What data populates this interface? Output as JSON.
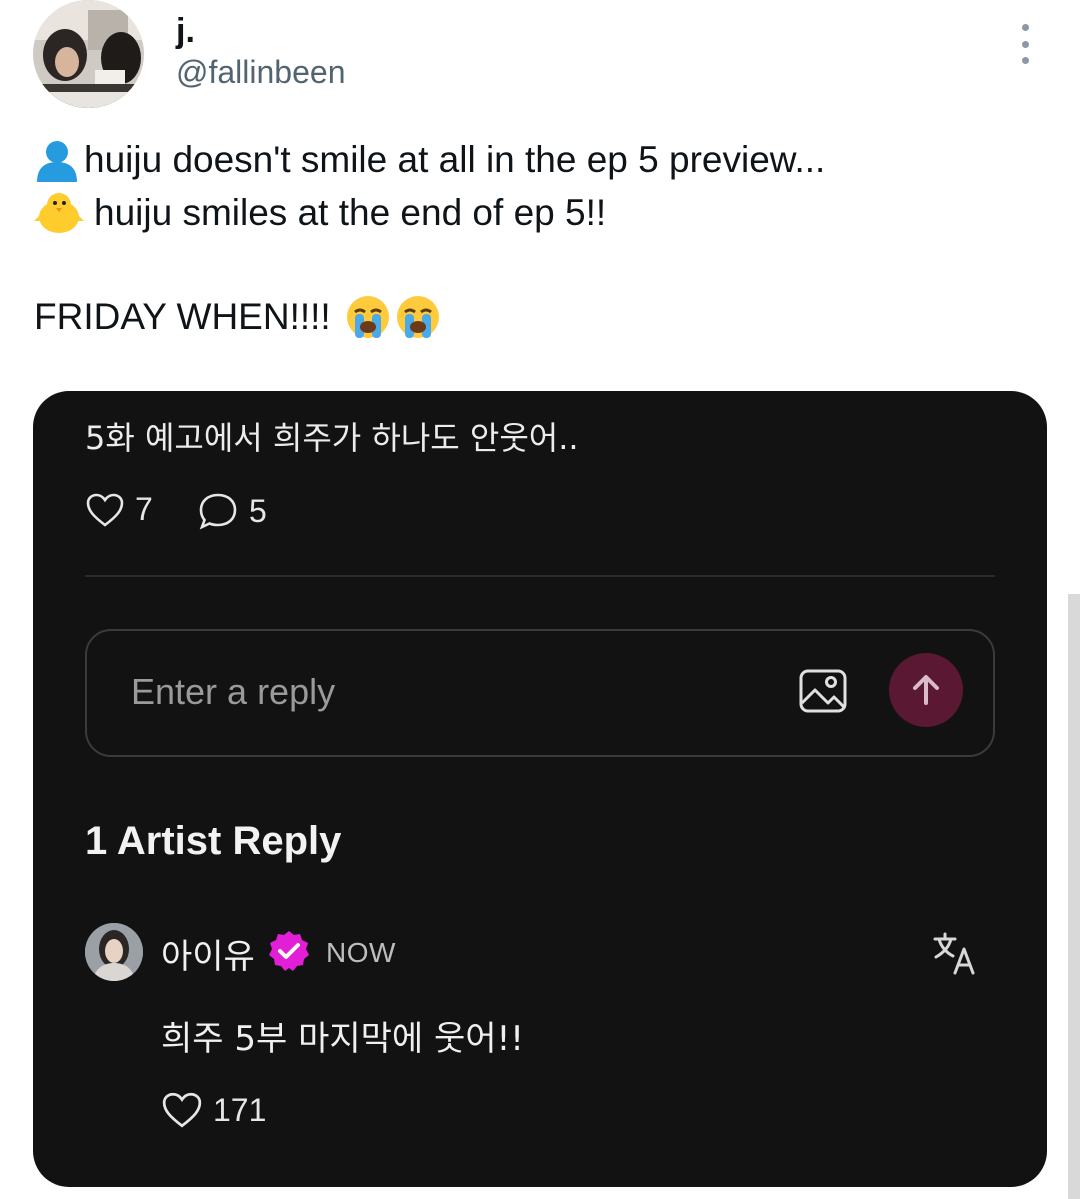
{
  "tweet": {
    "author": {
      "display_name": "j.",
      "handle": "@fallinbeen"
    },
    "lines": [
      {
        "icon": "bust-in-silhouette-emoji",
        "text": "huiju doesn't smile at all in the ep 5 preview..."
      },
      {
        "icon": "baby-chick-emoji",
        "text": "huiju smiles at the end of ep 5!!"
      },
      {
        "icon": "none",
        "text": "FRIDAY WHEN!!!!"
      }
    ],
    "line3_emoji": [
      "loudly-crying-face-emoji",
      "loudly-crying-face-emoji"
    ]
  },
  "card": {
    "post_text": "5화 예고에서 희주가 하나도 안웃어..",
    "likes": "7",
    "comments": "5",
    "reply_placeholder": "Enter a reply",
    "section_title": "1 Artist Reply",
    "artist_reply": {
      "name": "아이유",
      "timestamp": "NOW",
      "text": "희주 5부 마지막에 웃어!!",
      "likes": "171"
    },
    "colors": {
      "card_background": "#121212",
      "send_button": "#5a1832",
      "verified_badge": "#e21fd6"
    }
  }
}
